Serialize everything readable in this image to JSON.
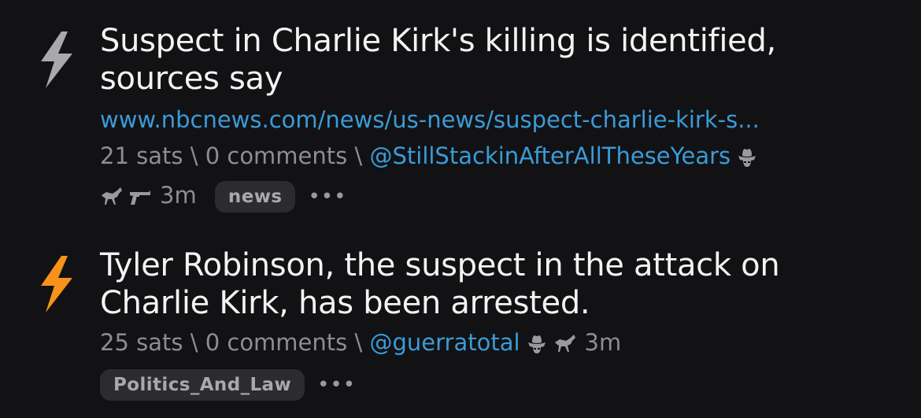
{
  "posts": [
    {
      "title": "Suspect in Charlie Kirk's killing is identified, sources say",
      "link": "www.nbcnews.com/news/us-news/suspect-charlie-kirk-s...",
      "sats": "21 sats",
      "sep1": " \\ ",
      "comments": "0 comments",
      "sep2": " \\ ",
      "author": "@StillStackinAfterAllTheseYears",
      "time": "3m",
      "tag": "news",
      "more": "•••",
      "bolt_color": "#a8a8ad",
      "badges": [
        "cowboy-hat-icon",
        "horse-icon",
        "gun-icon"
      ]
    },
    {
      "title": "Tyler Robinson, the suspect in the attack on Charlie Kirk, has been arrested.",
      "sats": "25 sats",
      "sep1": " \\ ",
      "comments": "0 comments",
      "sep2": " \\ ",
      "author": "@guerratotal",
      "time": "3m",
      "tag": "Politics_And_Law",
      "more": "•••",
      "bolt_color": "#f7931a",
      "badges": [
        "cowboy-hat-icon",
        "horse-icon"
      ]
    }
  ],
  "colors": {
    "background": "#121214",
    "link": "#3a9bd9",
    "meta": "#8d8d92",
    "tag_bg": "#2c2c2f"
  }
}
